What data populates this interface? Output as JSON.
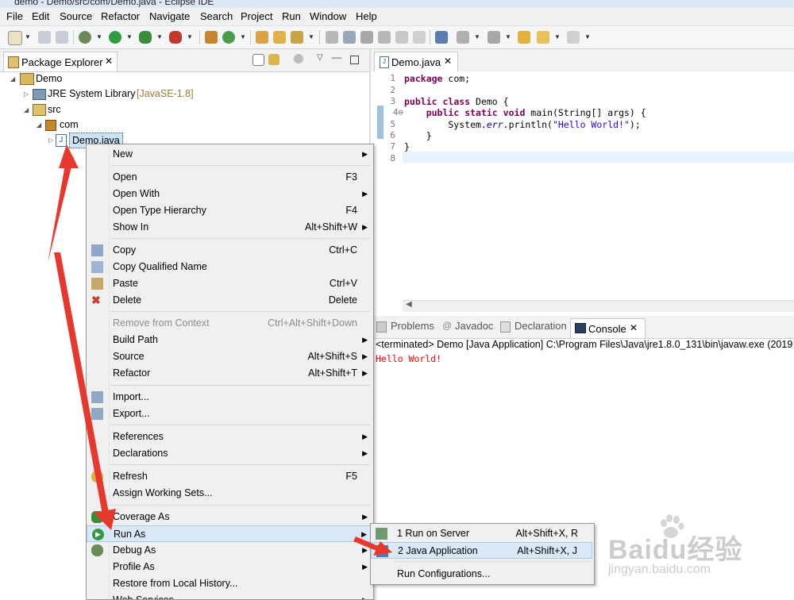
{
  "window": {
    "title": "demo - Demo/src/com/Demo.java - Eclipse IDE"
  },
  "menubar": [
    {
      "label": "File"
    },
    {
      "label": "Edit"
    },
    {
      "label": "Source"
    },
    {
      "label": "Refactor"
    },
    {
      "label": "Navigate"
    },
    {
      "label": "Search"
    },
    {
      "label": "Project"
    },
    {
      "label": "Run"
    },
    {
      "label": "Window"
    },
    {
      "label": "Help"
    }
  ],
  "package_explorer": {
    "tab_label": "Package Explorer",
    "tree": {
      "project": "Demo",
      "jre": "JRE System Library",
      "jre_version": "[JavaSE-1.8]",
      "src": "src",
      "package": "com",
      "file": "Demo.java"
    }
  },
  "editor": {
    "tab_label": "Demo.java",
    "line_numbers": [
      "1",
      "2",
      "3",
      "4⊖",
      "5",
      "6",
      "7",
      "8"
    ]
  },
  "context_menu": {
    "items": [
      {
        "label": "New",
        "shortcut": "",
        "submenu": true
      },
      {
        "label": "Open",
        "shortcut": "F3"
      },
      {
        "label": "Open With",
        "shortcut": "",
        "submenu": true
      },
      {
        "label": "Open Type Hierarchy",
        "shortcut": "F4"
      },
      {
        "label": "Show In",
        "shortcut": "Alt+Shift+W",
        "submenu": true
      },
      {
        "label": "Copy",
        "shortcut": "Ctrl+C",
        "icon": "copy-icon"
      },
      {
        "label": "Copy Qualified Name",
        "shortcut": "",
        "icon": "copy-qualified-icon"
      },
      {
        "label": "Paste",
        "shortcut": "Ctrl+V",
        "icon": "paste-icon"
      },
      {
        "label": "Delete",
        "shortcut": "Delete",
        "icon": "delete-icon"
      },
      {
        "label": "Remove from Context",
        "shortcut": "Ctrl+Alt+Shift+Down",
        "disabled": true
      },
      {
        "label": "Build Path",
        "shortcut": "",
        "submenu": true
      },
      {
        "label": "Source",
        "shortcut": "Alt+Shift+S",
        "submenu": true
      },
      {
        "label": "Refactor",
        "shortcut": "Alt+Shift+T",
        "submenu": true
      },
      {
        "label": "Import...",
        "shortcut": ""
      },
      {
        "label": "Export...",
        "shortcut": ""
      },
      {
        "label": "References",
        "shortcut": "",
        "submenu": true
      },
      {
        "label": "Declarations",
        "shortcut": "",
        "submenu": true
      },
      {
        "label": "Refresh",
        "shortcut": "F5"
      },
      {
        "label": "Assign Working Sets...",
        "shortcut": ""
      },
      {
        "label": "Coverage As",
        "shortcut": "",
        "submenu": true
      },
      {
        "label": "Run As",
        "shortcut": "",
        "submenu": true,
        "highlighted": true
      },
      {
        "label": "Debug As",
        "shortcut": "",
        "submenu": true
      },
      {
        "label": "Profile As",
        "shortcut": "",
        "submenu": true
      },
      {
        "label": "Restore from Local History...",
        "shortcut": ""
      },
      {
        "label": "Web Services",
        "shortcut": "",
        "submenu": true
      }
    ]
  },
  "run_as_submenu": {
    "items": [
      {
        "label": "1 Run on Server",
        "shortcut": "Alt+Shift+X, R"
      },
      {
        "label": "2 Java Application",
        "shortcut": "Alt+Shift+X, J",
        "highlighted": true
      },
      {
        "label": "Run Configurations...",
        "shortcut": ""
      }
    ]
  },
  "console": {
    "tabs": [
      {
        "label": "Problems"
      },
      {
        "label": "Javadoc"
      },
      {
        "label": "Declaration"
      },
      {
        "label": "Console"
      }
    ],
    "status": "<terminated> Demo [Java Application] C:\\Program Files\\Java\\jre1.8.0_131\\bin\\javaw.exe (2019",
    "output": "Hello World!"
  },
  "watermark": {
    "brand": "Baidu经验",
    "url": "jingyan.baidu.com"
  },
  "colors": {
    "accent_arrow": "#e8382d",
    "keyword": "#7f0055",
    "string": "#2a00ff",
    "console_output": "#ff0000"
  }
}
